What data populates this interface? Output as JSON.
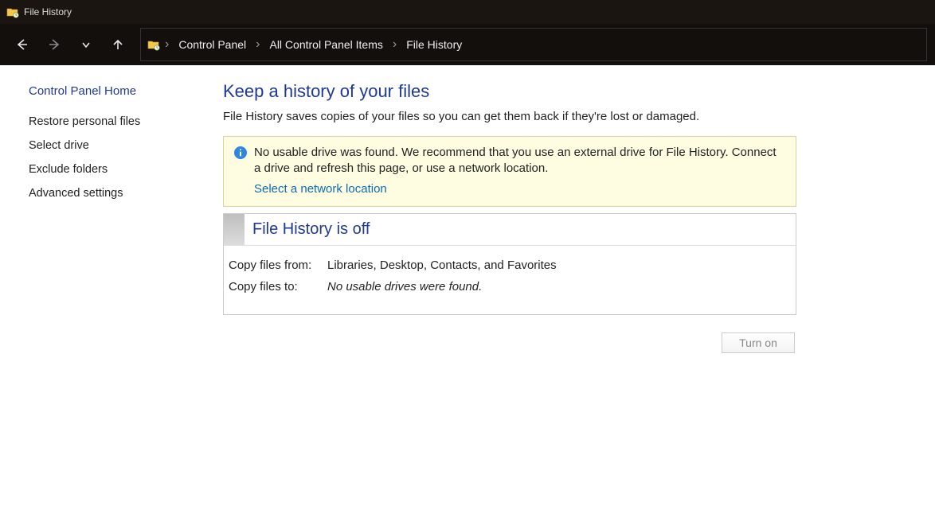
{
  "window": {
    "title": "File History"
  },
  "breadcrumbs": {
    "items": [
      {
        "label": "Control Panel"
      },
      {
        "label": "All Control Panel Items"
      },
      {
        "label": "File History"
      }
    ]
  },
  "sidebar": {
    "home": "Control Panel Home",
    "links": [
      "Restore personal files",
      "Select drive",
      "Exclude folders",
      "Advanced settings"
    ]
  },
  "main": {
    "title": "Keep a history of your files",
    "description": "File History saves copies of your files so you can get them back if they're lost or damaged.",
    "info": {
      "message": "No usable drive was found. We recommend that you use an external drive for File History. Connect a drive and refresh this page, or use a network location.",
      "link": "Select a network location"
    },
    "status": {
      "title": "File History is off",
      "copy_from_label": "Copy files from:",
      "copy_from_value": "Libraries, Desktop, Contacts, and Favorites",
      "copy_to_label": "Copy files to:",
      "copy_to_value": "No usable drives were found."
    },
    "turn_on_label": "Turn on"
  }
}
